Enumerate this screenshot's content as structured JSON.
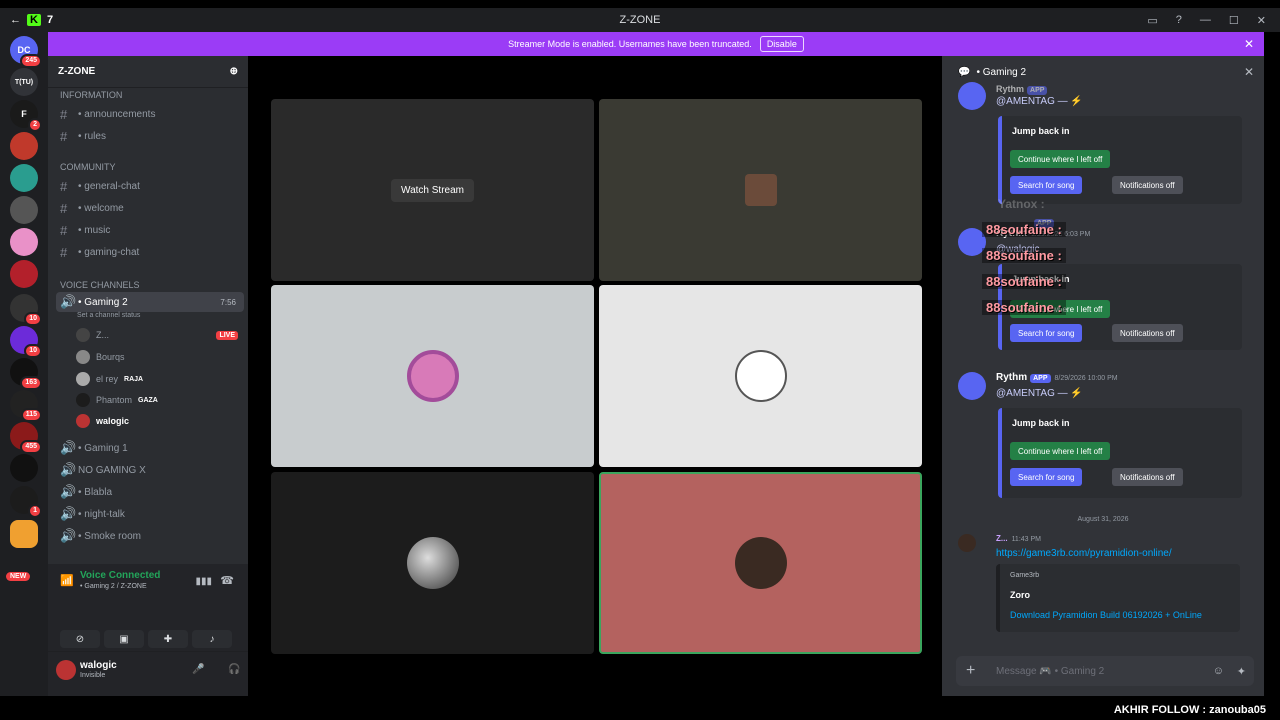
{
  "titlebar": {
    "back": "←",
    "kick_label": "K",
    "kick_num": "7",
    "title": "Z-ZONE",
    "inbox": "▭",
    "help": "?",
    "min": "—",
    "max": "☐",
    "close": "✕"
  },
  "banner": {
    "text": "Streamer Mode is enabled. Usernames have been truncated.",
    "disable": "Disable",
    "close": "✕"
  },
  "servers": [
    {
      "label": "DC",
      "badge": "245"
    },
    {
      "label": "T(TU)",
      "badge": ""
    },
    {
      "label": "F",
      "badge": "2"
    },
    {
      "label": "",
      "badge": ""
    },
    {
      "label": "",
      "badge": ""
    },
    {
      "label": "",
      "badge": ""
    },
    {
      "label": "",
      "badge": ""
    },
    {
      "label": "",
      "badge": ""
    },
    {
      "label": "",
      "badge": "10"
    },
    {
      "label": "",
      "badge": "10"
    },
    {
      "label": "",
      "badge": "163"
    },
    {
      "label": "",
      "badge": "115"
    },
    {
      "label": "",
      "badge": "455"
    },
    {
      "label": "",
      "badge": ""
    },
    {
      "label": "",
      "badge": "1"
    },
    {
      "label": "",
      "badge": ""
    }
  ],
  "new_badge": "NEW",
  "sidebar": {
    "server_name": "Z-ZONE",
    "categories": {
      "information": "INFORMATION",
      "community": "COMMUNITY",
      "voice": "VOICE CHANNELS"
    },
    "channels": {
      "announcements": "• announcements",
      "rules": "• rules",
      "general": "• general-chat",
      "welcome": "• welcome",
      "music": "• music",
      "gaming_chat": "• gaming-chat"
    },
    "voice": {
      "gaming2": "• Gaming 2",
      "gaming2_time": "7:56",
      "status": "Set a channel status",
      "gaming1": "• Gaming 1",
      "no_gaming": "NO GAMING X",
      "blabla": "• Blabla",
      "night": "• night-talk",
      "smoke": "• Smoke room"
    },
    "members": [
      {
        "name": "Z...",
        "tag": "",
        "live": "LIVE"
      },
      {
        "name": "Bourqs",
        "tag": "",
        "live": ""
      },
      {
        "name": "el rey",
        "tag": "RAJA",
        "live": ""
      },
      {
        "name": "Phantom",
        "tag": "GAZA",
        "live": ""
      },
      {
        "name": "walogic",
        "tag": "",
        "live": ""
      }
    ]
  },
  "voice_panel": {
    "connected": "Voice Connected",
    "sub": "• Gaming 2 / Z-ZONE"
  },
  "user_panel": {
    "name": "walogic",
    "status": "Invisible"
  },
  "stage": {
    "watch_stream": "Watch Stream"
  },
  "chat": {
    "header": "• Gaming 2",
    "messages": [
      {
        "author": "Rythm",
        "app": "APP",
        "time": "",
        "mention": "@AMENTAG — ⚡",
        "embed_title": "Jump back in",
        "btn1": "Continue where I left off",
        "btn2": "Search for song",
        "btn3": "Notifications off"
      },
      {
        "author": "Rythm",
        "app": "APP",
        "time": "8/29/2026 6:03 PM",
        "mention": "@walogic",
        "embed_title": "Jump back in",
        "btn1": "Continue where I left off",
        "btn2": "Search for song",
        "btn3": "Notifications off"
      },
      {
        "author": "Rythm",
        "app": "APP",
        "time": "8/29/2026 10:00 PM",
        "mention": "@AMENTAG — ⚡",
        "embed_title": "Jump back in",
        "btn1": "Continue where I left off",
        "btn2": "Search for song",
        "btn3": "Notifications off"
      }
    ],
    "overlay": [
      "88soufaine :",
      "88soufaine :",
      "88soufaine :",
      "88soufaine :"
    ],
    "overlay_ghost": "Yatnox :",
    "date_divider": "August 31, 2026",
    "last": {
      "author": "Z...",
      "time": "11:43 PM",
      "link": "https://game3rb.com/pyramidion-online/",
      "site": "Game3rb",
      "embed_author": "Zoro",
      "embed_link": "Download Pyramidion Build 06192026 + OnLine"
    },
    "input_placeholder": "Message 🎮 • Gaming 2"
  },
  "footer": {
    "follow": "AKHIR FOLLOW : zanouba05"
  },
  "colors": {
    "accent": "#9b3cf6",
    "blurple": "#5865f2",
    "green": "#248046",
    "live": "#f23f43"
  }
}
